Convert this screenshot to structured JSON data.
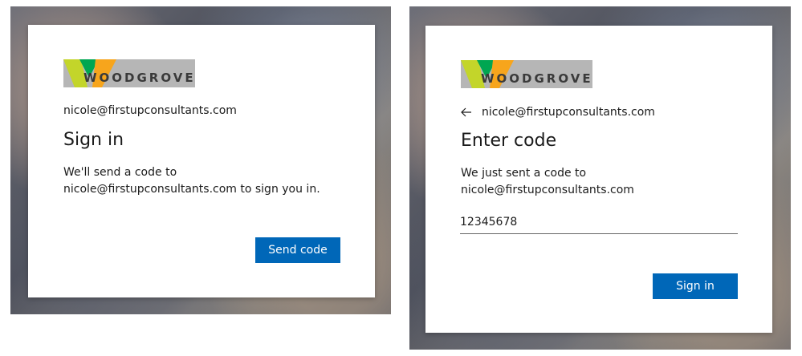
{
  "brand": {
    "logo_text": "WOODGROVE",
    "logo_bg": "#b6b6b6",
    "logo_colors": [
      "#c3d52a",
      "#00a651",
      "#f7a51c"
    ]
  },
  "colors": {
    "primary_button": "#0067b8",
    "text": "#1b1b1b"
  },
  "sign_in_card": {
    "email": "nicole@firstupconsultants.com",
    "title": "Sign in",
    "description": "We'll send a code to nicole@firstupconsultants.com to sign you in.",
    "button_label": "Send code"
  },
  "enter_code_card": {
    "back_icon": "back-arrow-icon",
    "email": "nicole@firstupconsultants.com",
    "title": "Enter code",
    "description": "We just sent a code to nicole@firstupconsultants.com",
    "code_value": "12345678",
    "button_label": "Sign in"
  }
}
